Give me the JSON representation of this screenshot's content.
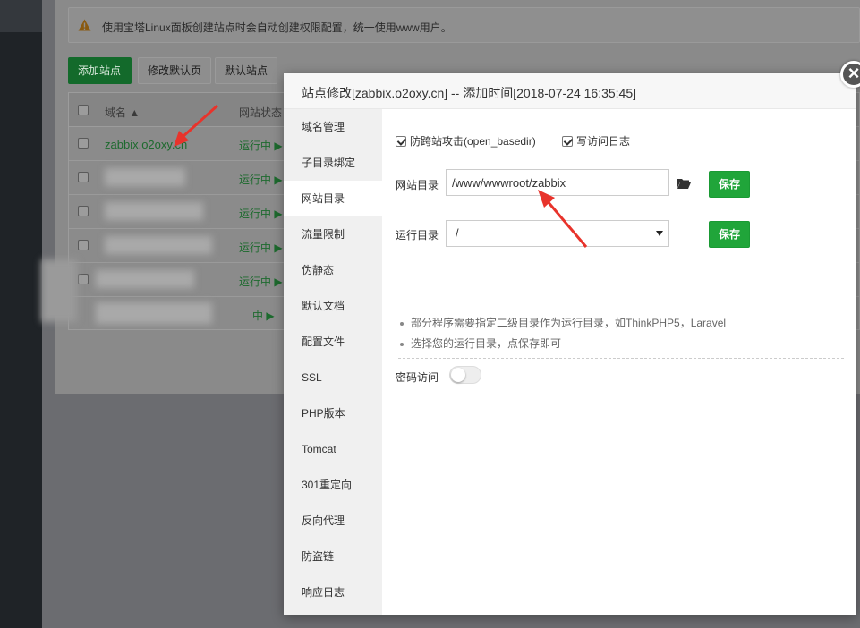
{
  "notice": {
    "text": "使用宝塔Linux面板创建站点时会自动创建权限配置，统一使用www用户。"
  },
  "toolbar": {
    "add_site": "添加站点",
    "edit_default_page": "修改默认页",
    "default_site": "默认站点"
  },
  "table": {
    "headers": {
      "domain": "域名 ▲",
      "status": "网站状态"
    },
    "rows": [
      {
        "domain": "zabbix.o2oxy.cn",
        "status": "运行中 ▶"
      },
      {
        "domain": "",
        "status": "运行中 ▶"
      },
      {
        "domain": "w...............m",
        "status": "运行中 ▶"
      },
      {
        "domain": "www.",
        "status": "运行中 ▶"
      },
      {
        "domain": "..com",
        "status": "运行中 ▶"
      },
      {
        "domain": ".......",
        "status": "中 ▶"
      }
    ]
  },
  "modal": {
    "title": "站点修改[zabbix.o2oxy.cn] -- 添加时间[2018-07-24 16:35:45]",
    "close_symbol": "×",
    "nav": [
      "域名管理",
      "子目录绑定",
      "网站目录",
      "流量限制",
      "伪静态",
      "默认文档",
      "配置文件",
      "SSL",
      "PHP版本",
      "Tomcat",
      "301重定向",
      "反向代理",
      "防盗链",
      "响应日志"
    ],
    "active_nav_index": 2,
    "checkbox_basedir": "防跨站攻击(open_basedir)",
    "checkbox_log": "写访问日志",
    "site_dir_label": "网站目录",
    "site_dir_value": "/www/wwwroot/zabbix",
    "run_dir_label": "运行目录",
    "run_dir_value": "/",
    "save_label": "保存",
    "tips": [
      "部分程序需要指定二级目录作为运行目录，如ThinkPHP5，Laravel",
      "选择您的运行目录，点保存即可"
    ],
    "password_access_label": "密码访问"
  },
  "colors": {
    "accent_green": "#20a53a",
    "arrow_red": "#e8332b"
  }
}
